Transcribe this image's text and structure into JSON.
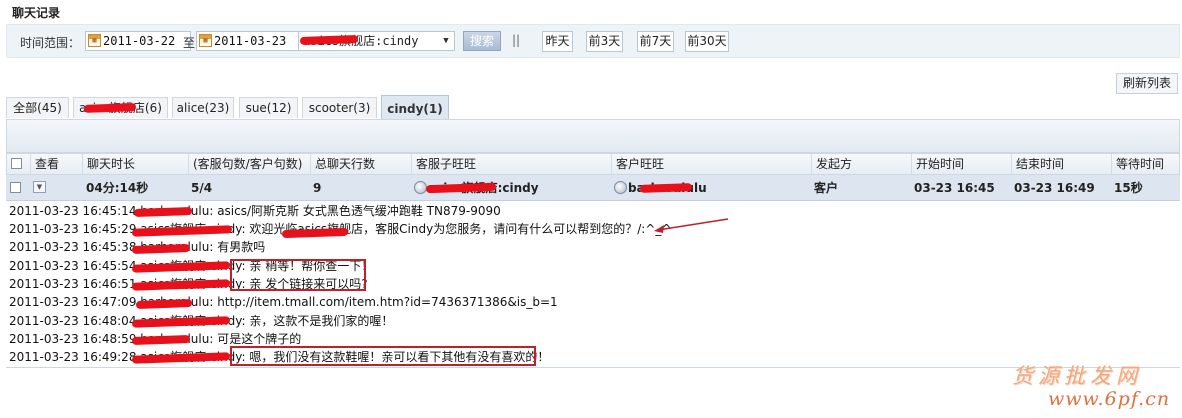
{
  "page": {
    "title": "聊天记录"
  },
  "filter": {
    "label": "时间范围：",
    "date_from": "2011-03-22",
    "to_text": "至",
    "date_to": "2011-03-23",
    "agent_selected": "asics旗舰店:cindy",
    "search_label": "搜索",
    "separator": "||",
    "quick_buttons": [
      "昨天",
      "前3天",
      "前7天",
      "前30天"
    ]
  },
  "refresh_label": "刷新列表",
  "tabs": [
    {
      "label": "全部(45)",
      "active": false
    },
    {
      "label": "asics旗舰店(6)",
      "active": false
    },
    {
      "label": "alice(23)",
      "active": false
    },
    {
      "label": "sue(12)",
      "active": false
    },
    {
      "label": "scooter(3)",
      "active": false
    },
    {
      "label": "cindy(1)",
      "active": true
    }
  ],
  "table": {
    "headers": [
      "查看",
      "聊天时长",
      "(客服句数/客户句数)",
      "总聊天行数",
      "客服子旺旺",
      "客户旺旺",
      "发起方",
      "开始时间",
      "结束时间",
      "等待时间"
    ],
    "row": {
      "duration": "04分:14秒",
      "ratio": "5/4",
      "lines": "9",
      "agent_ww": "asics旗舰店:cindy",
      "customer_ww": "barbaralulu",
      "initiator": "客户",
      "start": "03-23 16:45",
      "end": "03-23 16:49",
      "wait": "15秒"
    }
  },
  "log": [
    {
      "ts": "2011-03-23 16:45:14",
      "speaker": "barbaralulu:",
      "text": "asics/阿斯克斯 女式黑色透气缓冲跑鞋 TN879-9090"
    },
    {
      "ts": "2011-03-23 16:45:29",
      "speaker": "asics旗舰店:cindy:",
      "text": "欢迎光临asics旗舰店，客服Cindy为您服务，请问有什么可以帮到您的？/:^_^"
    },
    {
      "ts": "2011-03-23 16:45:38",
      "speaker": "barbaralulu:",
      "text": "有男款吗"
    },
    {
      "ts": "2011-03-23 16:45:54",
      "speaker": "asics旗舰店:cindy:",
      "text": "亲 稍等！帮你查一下！"
    },
    {
      "ts": "2011-03-23 16:46:51",
      "speaker": "asics旗舰店:cindy:",
      "text": "亲 发个链接来可以吗?"
    },
    {
      "ts": "2011-03-23 16:47:09",
      "speaker": "barbaralulu:",
      "text": "http://item.tmall.com/item.htm?id=7436371386&is_b=1"
    },
    {
      "ts": "2011-03-23 16:48:04",
      "speaker": "asics旗舰店:cindy:",
      "text": "亲，这款不是我们家的喔！"
    },
    {
      "ts": "2011-03-23 16:48:59",
      "speaker": "barbaralulu:",
      "text": "可是这个牌子的"
    },
    {
      "ts": "2011-03-23 16:49:28",
      "speaker": "asics旗舰店:cindy:",
      "text": "嗯，我们没有这款鞋喔！亲可以看下其他有没有喜欢的！"
    }
  ],
  "watermark": {
    "title": "货源批发网",
    "url": "www.6pf.cn"
  },
  "colors": {
    "annotation_red": "#c0202a",
    "redaction_red": "#e8101a",
    "accent_blue": "#dde6f0"
  }
}
